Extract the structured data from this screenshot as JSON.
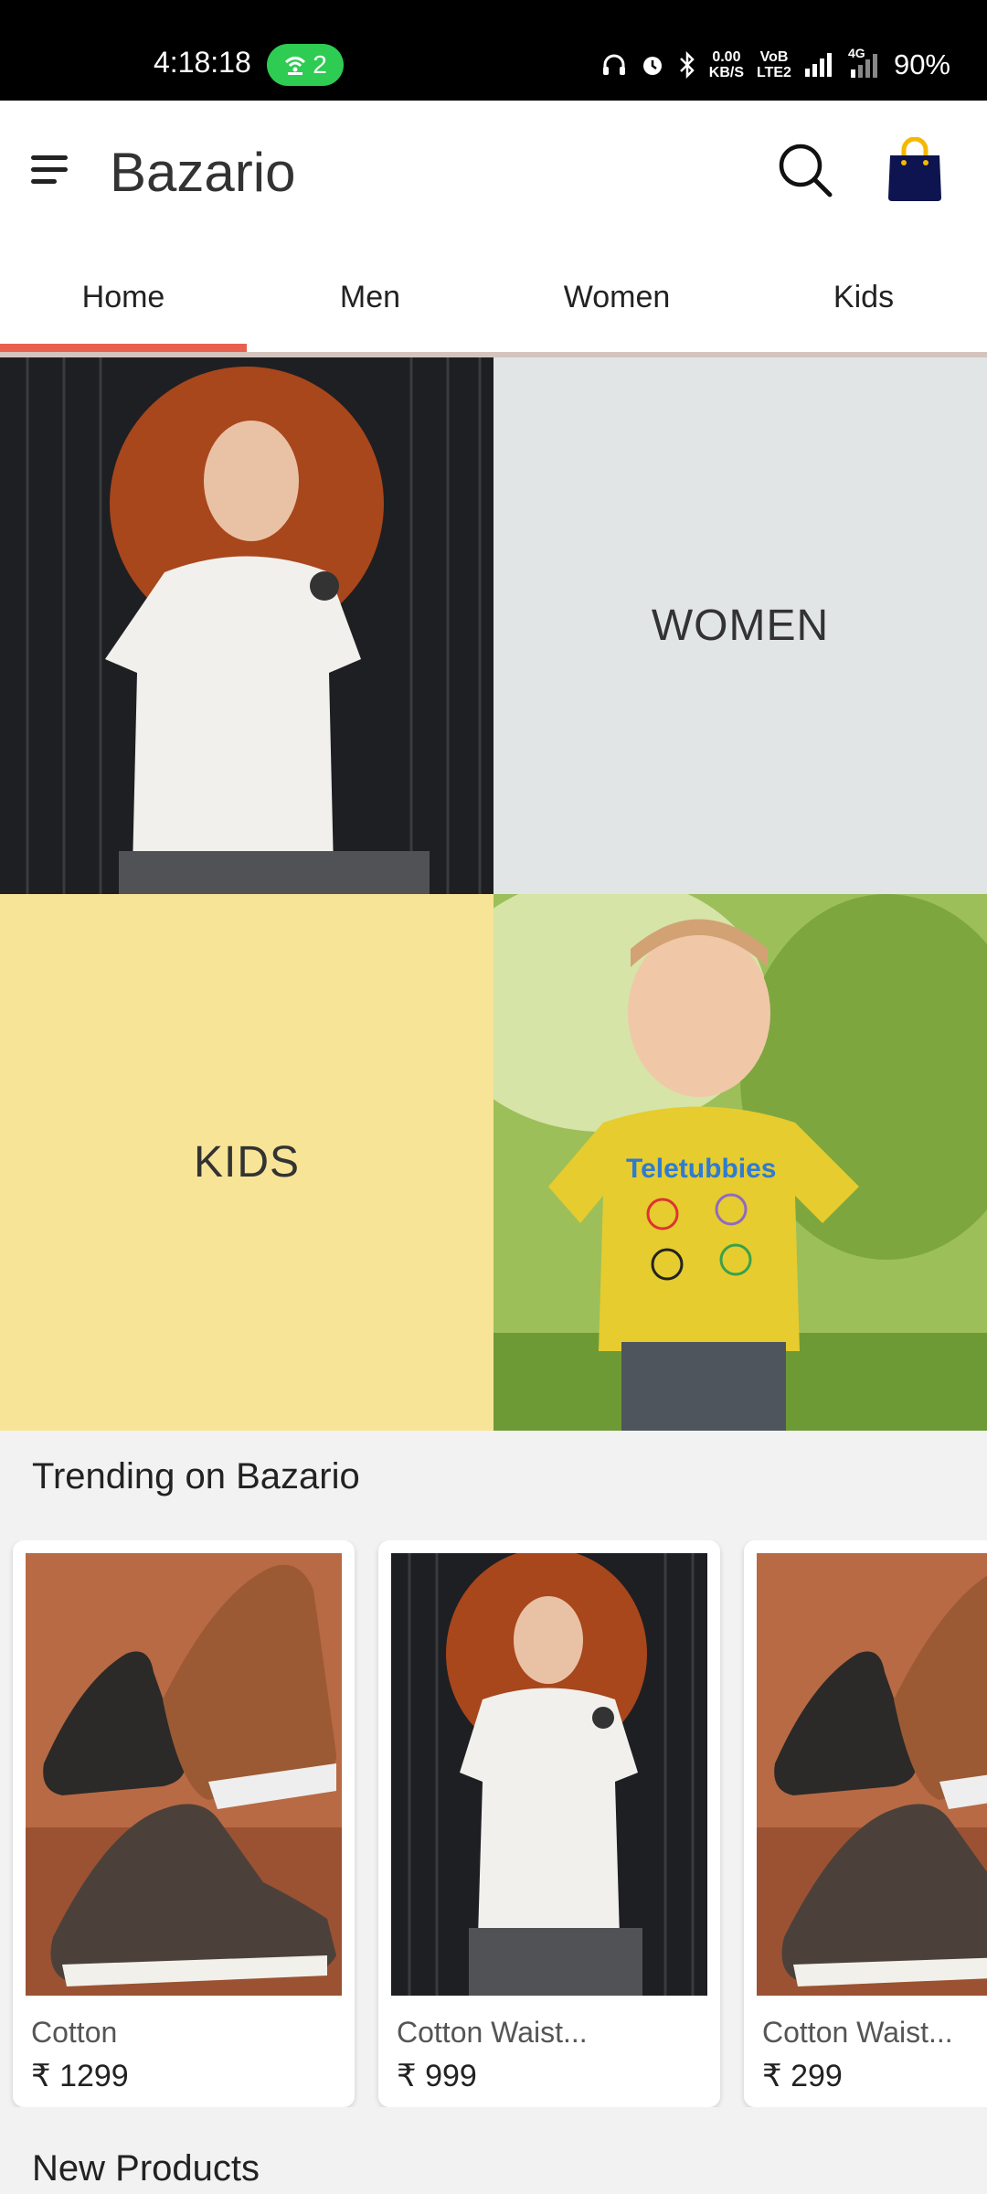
{
  "status_bar": {
    "time": "4:18:18",
    "hotspot_count": "2",
    "net_speed_value": "0.00",
    "net_speed_unit": "KB/S",
    "volte_top": "VoB",
    "volte_bottom": "LTE2",
    "network_label": "4G",
    "battery": "90%"
  },
  "app_bar": {
    "title": "Bazario",
    "menu_icon": "hamburger-menu-icon",
    "search_icon": "search-icon",
    "cart_icon": "shopping-bag-icon",
    "cart_color": "#0d1450",
    "cart_handle_color": "#f5b800"
  },
  "tabs": [
    {
      "label": "Home",
      "active": true
    },
    {
      "label": "Men",
      "active": false
    },
    {
      "label": "Women",
      "active": false
    },
    {
      "label": "Kids",
      "active": false
    }
  ],
  "accent_color": "#e8614f",
  "categories": {
    "women_label": "WOMEN",
    "women_bg": "#e2e5e6",
    "kids_label": "KIDS",
    "kids_bg": "#f7e497"
  },
  "trending": {
    "title": "Trending on Bazario",
    "products": [
      {
        "name": "Cotton",
        "price": "₹ 1299",
        "image": "sneakers-photo"
      },
      {
        "name": "Cotton Waist...",
        "price": "₹ 999",
        "image": "woman-white-tshirt-photo"
      },
      {
        "name": "Cotton Waist...",
        "price": "₹ 299",
        "image": "sneakers-photo"
      }
    ]
  },
  "new_products": {
    "title": "New Products"
  }
}
